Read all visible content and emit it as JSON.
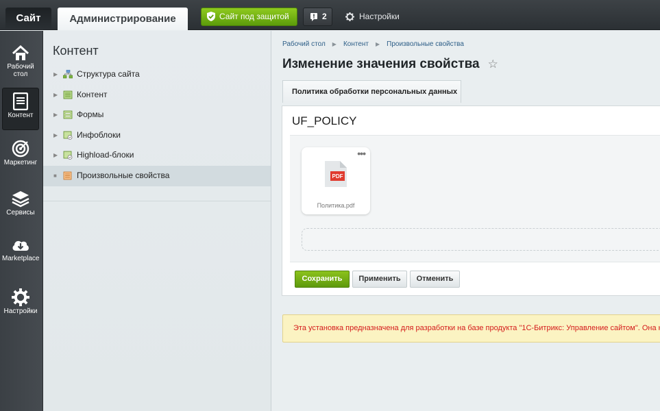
{
  "topbar": {
    "tab_site": "Сайт",
    "tab_admin": "Администрирование",
    "protected_label": "Сайт под защитой",
    "notify_count": "2",
    "settings_label": "Настройки"
  },
  "leftbar": {
    "items": [
      {
        "label": "Рабочий стол",
        "icon": "home-icon"
      },
      {
        "label": "Контент",
        "icon": "document-icon"
      },
      {
        "label": "Маркетинг",
        "icon": "target-icon"
      },
      {
        "label": "Сервисы",
        "icon": "layers-icon"
      },
      {
        "label": "Marketplace",
        "icon": "cloud-download-icon"
      },
      {
        "label": "Настройки",
        "icon": "gear-icon"
      }
    ],
    "active_index": 1
  },
  "menu": {
    "title": "Контент",
    "items": [
      {
        "label": "Структура сайта",
        "icon": "site-structure-icon"
      },
      {
        "label": "Контент",
        "icon": "content-icon"
      },
      {
        "label": "Формы",
        "icon": "forms-icon"
      },
      {
        "label": "Инфоблоки",
        "icon": "iblocks-icon"
      },
      {
        "label": "Highload-блоки",
        "icon": "highload-icon"
      },
      {
        "label": "Произвольные свойства",
        "icon": "custom-props-icon"
      }
    ],
    "active_index": 5
  },
  "breadcrumbs": [
    "Рабочий стол",
    "Контент",
    "Произвольные свойства"
  ],
  "page_title": "Изменение значения свойства",
  "form": {
    "tab_label": "Политика обработки персональных данных",
    "property_code": "UF_POLICY",
    "file": {
      "name": "Политика.pdf",
      "type_badge": "PDF",
      "menu_glyph": "•••"
    },
    "buttons": {
      "save": "Сохранить",
      "apply": "Применить",
      "cancel": "Отменить"
    }
  },
  "notice": "Эта установка предназначена для разработки на базе продукта \"1С-Битрикс: Управление сайтом\". Она не для работы сайта.",
  "colors": {
    "accent_green": "#6aaa12",
    "notice_red": "#d41a1a",
    "link_blue": "#2d5e87"
  }
}
